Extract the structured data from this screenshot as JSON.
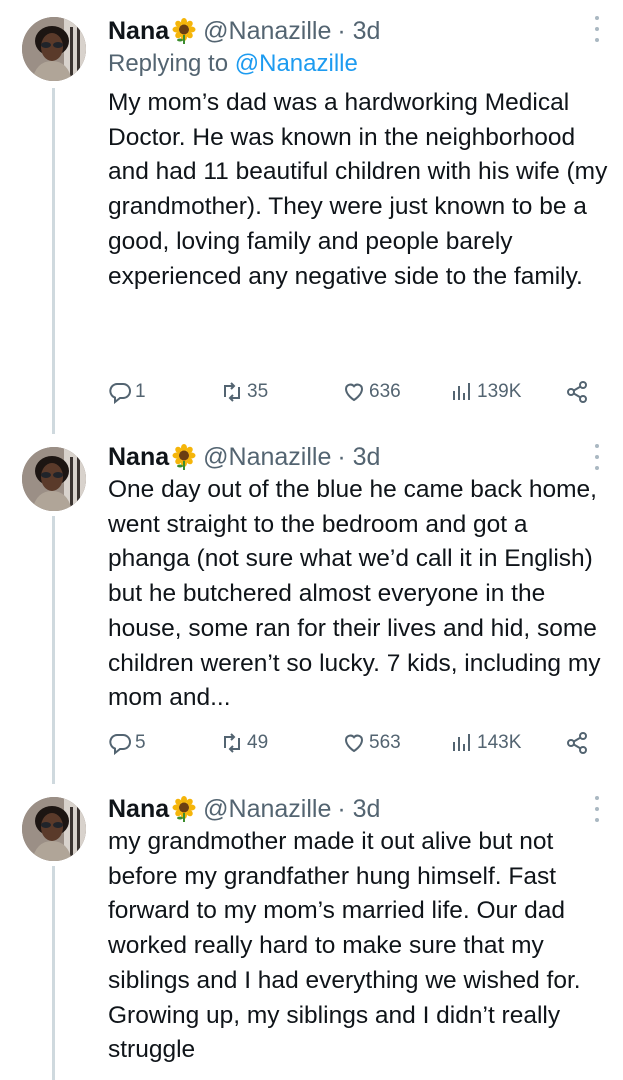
{
  "colors": {
    "text": "#0f1419",
    "secondary": "#536471",
    "link": "#1d9bf0",
    "thread_line": "#cfd9de"
  },
  "tweets": [
    {
      "name": "Nana",
      "emoji": "sunflower",
      "handle": "@Nanazille",
      "time": "· 3d",
      "replying_prefix": "Replying to",
      "replying_handle": "@Nanazille",
      "text": "My mom’s dad was a hardworking Medical Doctor. He was known in the neighborhood and had 11 beautiful children with his wife (my grandmother). They were just known to be a good, loving family and people barely experienced any negative side to the family.",
      "replies": "1",
      "retweets": "35",
      "likes": "636",
      "views": "139K"
    },
    {
      "name": "Nana",
      "emoji": "sunflower",
      "handle": "@Nanazille",
      "time": "· 3d",
      "text": "One day out of the blue he came back home, went straight to the bedroom and got a phanga (not sure what we’d call it in English) but he butchered almost everyone in the house, some ran for their lives and hid, some children weren’t so lucky. 7 kids, including my mom and...",
      "replies": "5",
      "retweets": "49",
      "likes": "563",
      "views": "143K"
    },
    {
      "name": "Nana",
      "emoji": "sunflower",
      "handle": "@Nanazille",
      "time": "· 3d",
      "text": "my grandmother made it out alive but not before my grandfather hung himself. Fast forward to my mom’s married life. Our dad worked really hard to make sure that my siblings and I had everything we wished for. Growing up, my siblings and I didn’t really struggle"
    }
  ]
}
